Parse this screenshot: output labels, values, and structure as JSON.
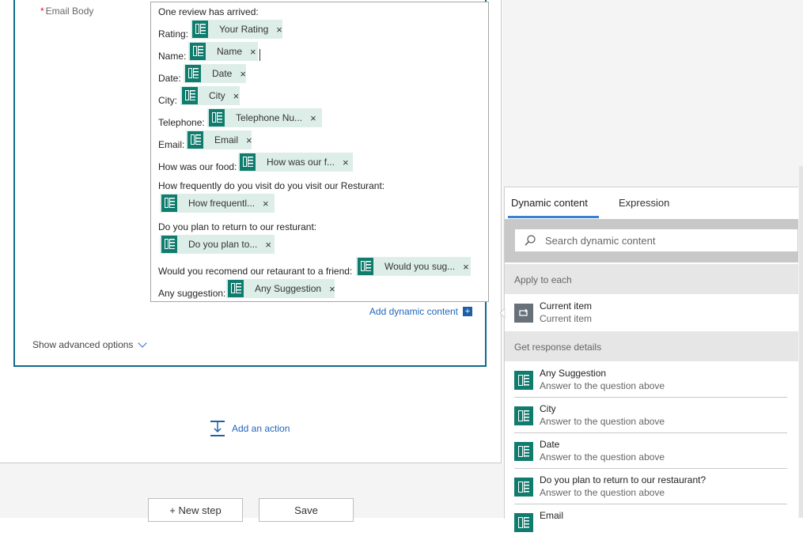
{
  "email_body": {
    "label": "Email Body",
    "required_marker": "*",
    "lines": [
      {
        "text": "One review has arrived:"
      },
      {
        "text": "Rating:",
        "token": "Your Rating"
      },
      {
        "text": "Name:",
        "token": "Name"
      },
      {
        "text": "Date:",
        "token": "Date"
      },
      {
        "text": "City:",
        "token": "City"
      },
      {
        "text": "Telephone:",
        "token": "Telephone Nu..."
      },
      {
        "text": "Email:",
        "token": "Email"
      },
      {
        "text": "How was our food:",
        "token": "How was our f..."
      },
      {
        "text": "How frequently do you visit do you visit our Resturant:"
      },
      {
        "token": "How frequentl..."
      },
      {
        "text": "Do you plan to return to our resturant:"
      },
      {
        "token": "Do you plan to..."
      },
      {
        "text": "Would you recomend our retaurant to a friend:",
        "token": "Would you sug..."
      },
      {
        "text": "Any suggestion:",
        "token": "Any Suggestion"
      }
    ],
    "token_close": "×",
    "add_dynamic_content": "Add dynamic content",
    "add_dynamic_plus": "+"
  },
  "show_advanced": "Show advanced options",
  "add_action": "Add an action",
  "buttons": {
    "new_step": "+ New step",
    "save": "Save"
  },
  "dynamic_panel": {
    "tabs": [
      "Dynamic content",
      "Expression"
    ],
    "active_tab": "Dynamic content",
    "search_placeholder": "Search dynamic content",
    "sections": [
      {
        "title": "Apply to each",
        "items": [
          {
            "title": "Current item",
            "subtitle": "Current item",
            "icon": "loop-icon"
          }
        ]
      },
      {
        "title": "Get response details",
        "items": [
          {
            "title": "Any Suggestion",
            "subtitle": "Answer to the question above",
            "icon": "forms-icon"
          },
          {
            "title": "City",
            "subtitle": "Answer to the question above",
            "icon": "forms-icon"
          },
          {
            "title": "Date",
            "subtitle": "Answer to the question above",
            "icon": "forms-icon"
          },
          {
            "title": "Do you plan to return to our restaurant?",
            "subtitle": "Answer to the question above",
            "icon": "forms-icon"
          },
          {
            "title": "Email",
            "subtitle": "",
            "icon": "forms-icon"
          }
        ]
      }
    ]
  },
  "colors": {
    "accent": "#0f6b8a",
    "link": "#2266bb",
    "forms_green": "#107c6e",
    "token_bg": "#ddeee8",
    "tab_underline": "#3a7fd0"
  }
}
